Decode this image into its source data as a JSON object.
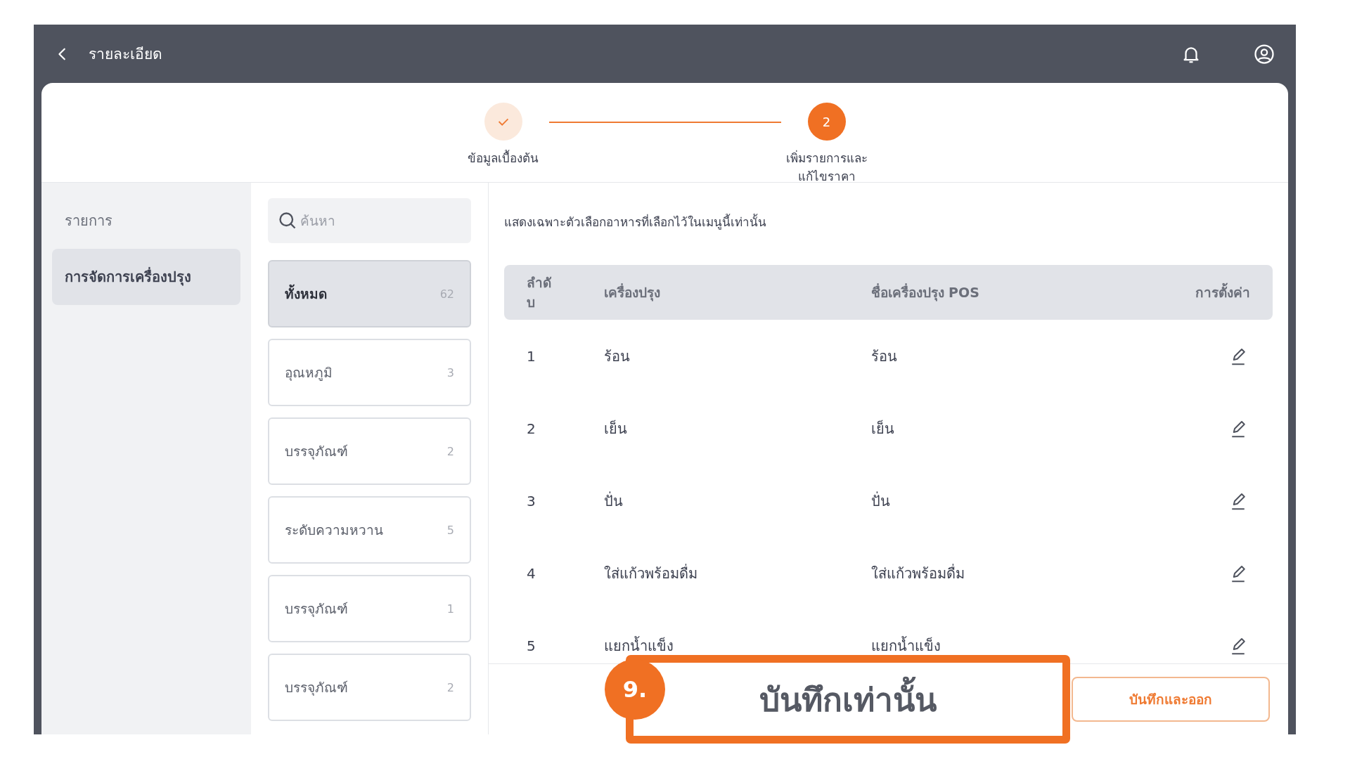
{
  "top_bar": {
    "title": "รายละเอียด"
  },
  "stepper": [
    {
      "done": true,
      "label_lines": [
        "ข้อมูลเบื้องต้น"
      ]
    },
    {
      "done": false,
      "number": "2",
      "label_lines": [
        "เพิ่มรายการและ",
        "แก้ไขราคา"
      ]
    }
  ],
  "sidebar": {
    "heading": "รายการ",
    "items": [
      {
        "label": "การจัดการเครื่องปรุง",
        "selected": true
      }
    ]
  },
  "search": {
    "placeholder": "ค้นหา"
  },
  "categories": [
    {
      "label": "ทั้งหมด",
      "count": "62",
      "selected": true
    },
    {
      "label": "อุณหภูมิ",
      "count": "3",
      "selected": false
    },
    {
      "label": "บรรจุภัณฑ์",
      "count": "2",
      "selected": false
    },
    {
      "label": "ระดับความหวาน",
      "count": "5",
      "selected": false
    },
    {
      "label": "บรรจุภัณฑ์",
      "count": "1",
      "selected": false
    },
    {
      "label": "บรรจุภัณฑ์",
      "count": "2",
      "selected": false
    }
  ],
  "note": "แสดงเฉพาะตัวเลือกอาหารที่เลือกไว้ในเมนูนี้เท่านั้น",
  "table": {
    "columns": [
      "ลำดับ",
      "เครื่องปรุง",
      "ชื่อเครื่องปรุง POS",
      "การตั้งค่า"
    ],
    "rows": [
      {
        "no": "1",
        "name": "ร้อน",
        "pos_name": "ร้อน"
      },
      {
        "no": "2",
        "name": "เย็น",
        "pos_name": "เย็น"
      },
      {
        "no": "3",
        "name": "ปั่น",
        "pos_name": "ปั่น"
      },
      {
        "no": "4",
        "name": "ใส่แก้วพร้อมดื่ม",
        "pos_name": "ใส่แก้วพร้อมดื่ม"
      },
      {
        "no": "5",
        "name": "แยกน้ำแข็ง",
        "pos_name": "แยกน้ำแข็ง"
      }
    ]
  },
  "footer": {
    "save_exit_button": "บันทึกและออก"
  },
  "annotation": {
    "number": "9.",
    "label": "บันทึกเท่านั้น"
  }
}
